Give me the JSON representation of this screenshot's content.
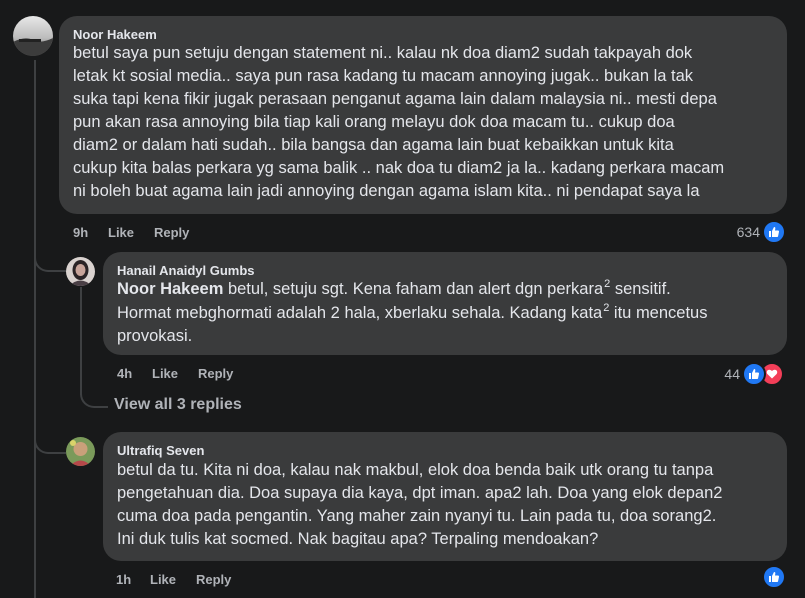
{
  "comments": [
    {
      "author": "Noor Hakeem",
      "lines": [
        "betul saya pun setuju dengan statement ni.. kalau nk doa diam2 sudah takpayah dok",
        "letak kt sosial media.. saya pun rasa kadang tu macam annoying jugak.. bukan la tak",
        "suka tapi kena fikir jugak perasaan penganut agama lain dalam malaysia ni.. mesti depa",
        "pun akan rasa annoying bila tiap kali orang melayu dok doa macam tu.. cukup doa",
        "diam2 or dalam hati sudah.. bila bangsa dan agama lain buat kebaikkan untuk kita",
        "cukup kita balas perkara yg sama balik .. nak doa tu diam2 ja la.. kadang perkara macam",
        "ni boleh buat agama lain jadi annoying dengan agama islam kita.. ni pendapat saya la"
      ],
      "time": "9h",
      "like_label": "Like",
      "reply_label": "Reply",
      "reaction_count": "634",
      "reactions": [
        "like-icon"
      ]
    },
    {
      "author": "Hanail Anaidyl Gumbs",
      "mention": "Noor Hakeem",
      "line1_a": " betul, setuju sgt. Kena faham dan alert dgn perkara",
      "sup1": "2",
      "line1_b": " sensitif.",
      "line2": "Hormat mebghormati adalah 2 hala, xberlaku sehala. Kadang kata",
      "sup2": "2",
      "line2_b": " itu mencetus",
      "line3": "provokasi.",
      "time": "4h",
      "like_label": "Like",
      "reply_label": "Reply",
      "reaction_count": "44",
      "reactions": [
        "like-icon",
        "heart-icon"
      ]
    },
    {
      "author": "Ultrafiq Seven",
      "lines": [
        "betul da tu. Kita ni doa, kalau nak makbul, elok doa benda baik utk orang tu tanpa",
        "pengetahuan dia. Doa supaya dia kaya, dpt iman. apa2 lah. Doa yang elok depan2",
        "cuma doa pada pengantin. Yang maher zain nyanyi tu. Lain pada tu, doa sorang2.",
        "Ini duk tulis kat socmed. Nak bagitau apa? Terpaling mendoakan?"
      ],
      "time": "1h",
      "like_label": "Like",
      "reply_label": "Reply",
      "reactions": [
        "like-icon"
      ]
    }
  ],
  "view_replies_label": "View all 3 replies",
  "colors": {
    "background": "#18191a",
    "bubble": "#3a3b3c",
    "text": "#e4e6eb",
    "secondary": "#b0b3b8",
    "like_blue": "#2078f4",
    "love_red": "#f33e58"
  }
}
